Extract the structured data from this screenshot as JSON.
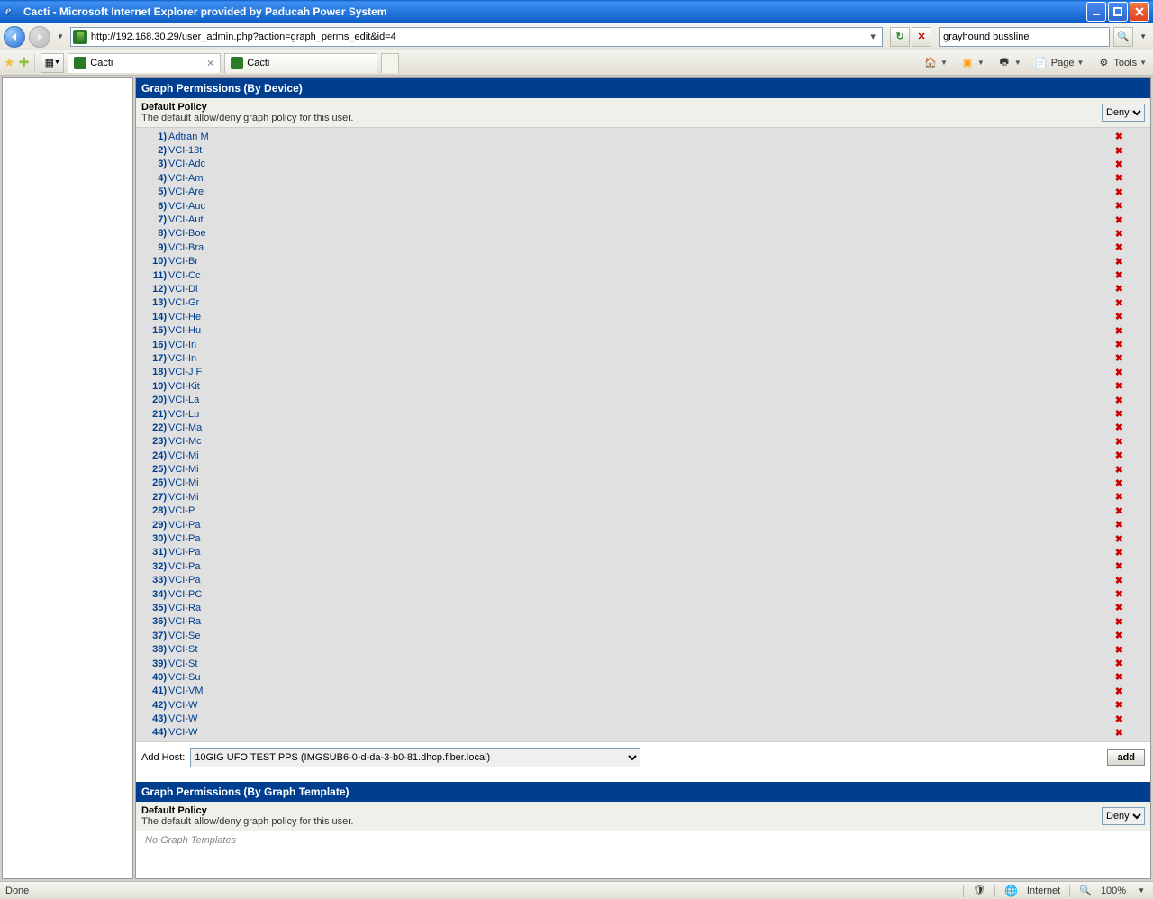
{
  "window": {
    "title": "Cacti - Microsoft Internet Explorer provided by Paducah Power System"
  },
  "nav": {
    "url": "http://192.168.30.29/user_admin.php?action=graph_perms_edit&id=4",
    "search_value": "grayhound bussline"
  },
  "tabs": [
    {
      "label": "Cacti",
      "active": true,
      "closable": true
    },
    {
      "label": "Cacti",
      "active": false,
      "closable": false
    }
  ],
  "toolbar_right": {
    "page": "Page",
    "tools": "Tools"
  },
  "section_device": {
    "title": "Graph Permissions (By Device)",
    "policy_label": "Default Policy",
    "policy_desc": "The default allow/deny graph policy for this user.",
    "policy_value": "Deny",
    "devices": [
      "Adtran M",
      "VCI-13t",
      "VCI-Adc",
      "VCI-Am",
      "VCI-Are",
      "VCI-Auc",
      "VCI-Aut",
      "VCI-Boe",
      "VCI-Bra",
      "VCI-Br",
      "VCI-Cc",
      "VCI-Di",
      "VCI-Gr",
      "VCI-He",
      "VCI-Hu",
      "VCI-In",
      "VCI-In",
      "VCI-J F",
      "VCI-Kit",
      "VCI-La",
      "VCI-Lu",
      "VCI-Ma",
      "VCI-Mc",
      "VCI-Mi",
      "VCI-Mi",
      "VCI-Mi",
      "VCI-Mi",
      "VCI-P",
      "VCI-Pa",
      "VCI-Pa",
      "VCI-Pa",
      "VCI-Pa",
      "VCI-Pa",
      "VCI-PC",
      "VCI-Ra",
      "VCI-Ra",
      "VCI-Se",
      "VCI-St",
      "VCI-St",
      "VCI-Su",
      "VCI-VM",
      "VCI-W",
      "VCI-W",
      "VCI-W"
    ],
    "add_host_label": "Add Host:",
    "add_host_selected": "10GIG UFO TEST PPS (IMGSUB6-0-d-da-3-b0-81.dhcp.fiber.local)",
    "add_button": "add"
  },
  "section_template": {
    "title": "Graph Permissions (By Graph Template)",
    "policy_label": "Default Policy",
    "policy_desc": "The default allow/deny graph policy for this user.",
    "policy_value": "Deny",
    "empty": "No Graph Templates"
  },
  "statusbar": {
    "left": "Done",
    "zone": "Internet",
    "zoom": "100%"
  }
}
